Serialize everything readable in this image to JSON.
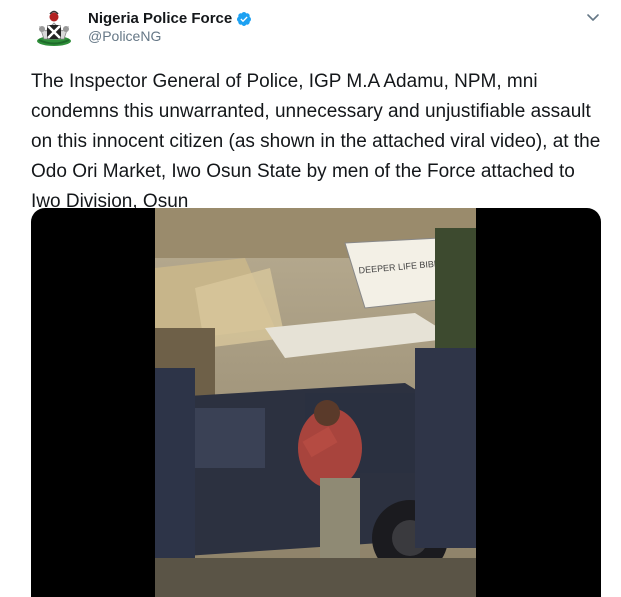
{
  "user": {
    "display_name": "Nigeria Police Force",
    "handle": "@PoliceNG",
    "verified": true,
    "avatar_icon": "police-crest-icon"
  },
  "tweet": {
    "text": "The Inspector General of Police, IGP M.A Adamu, NPM, mni condemns this unwarranted, unnecessary and unjustifiable assault on this innocent citizen (as shown in the attached viral video), at the Odo Ori Market, Iwo Osun State by men of the Force attached to Iwo Division, Osun"
  },
  "media": {
    "type": "video",
    "sign_text": "DEEPER LIFE BIBLE CHURCH"
  },
  "colors": {
    "text": "#14171a",
    "secondary": "#657786",
    "verified": "#1da1f2",
    "media_bg": "#000000"
  }
}
